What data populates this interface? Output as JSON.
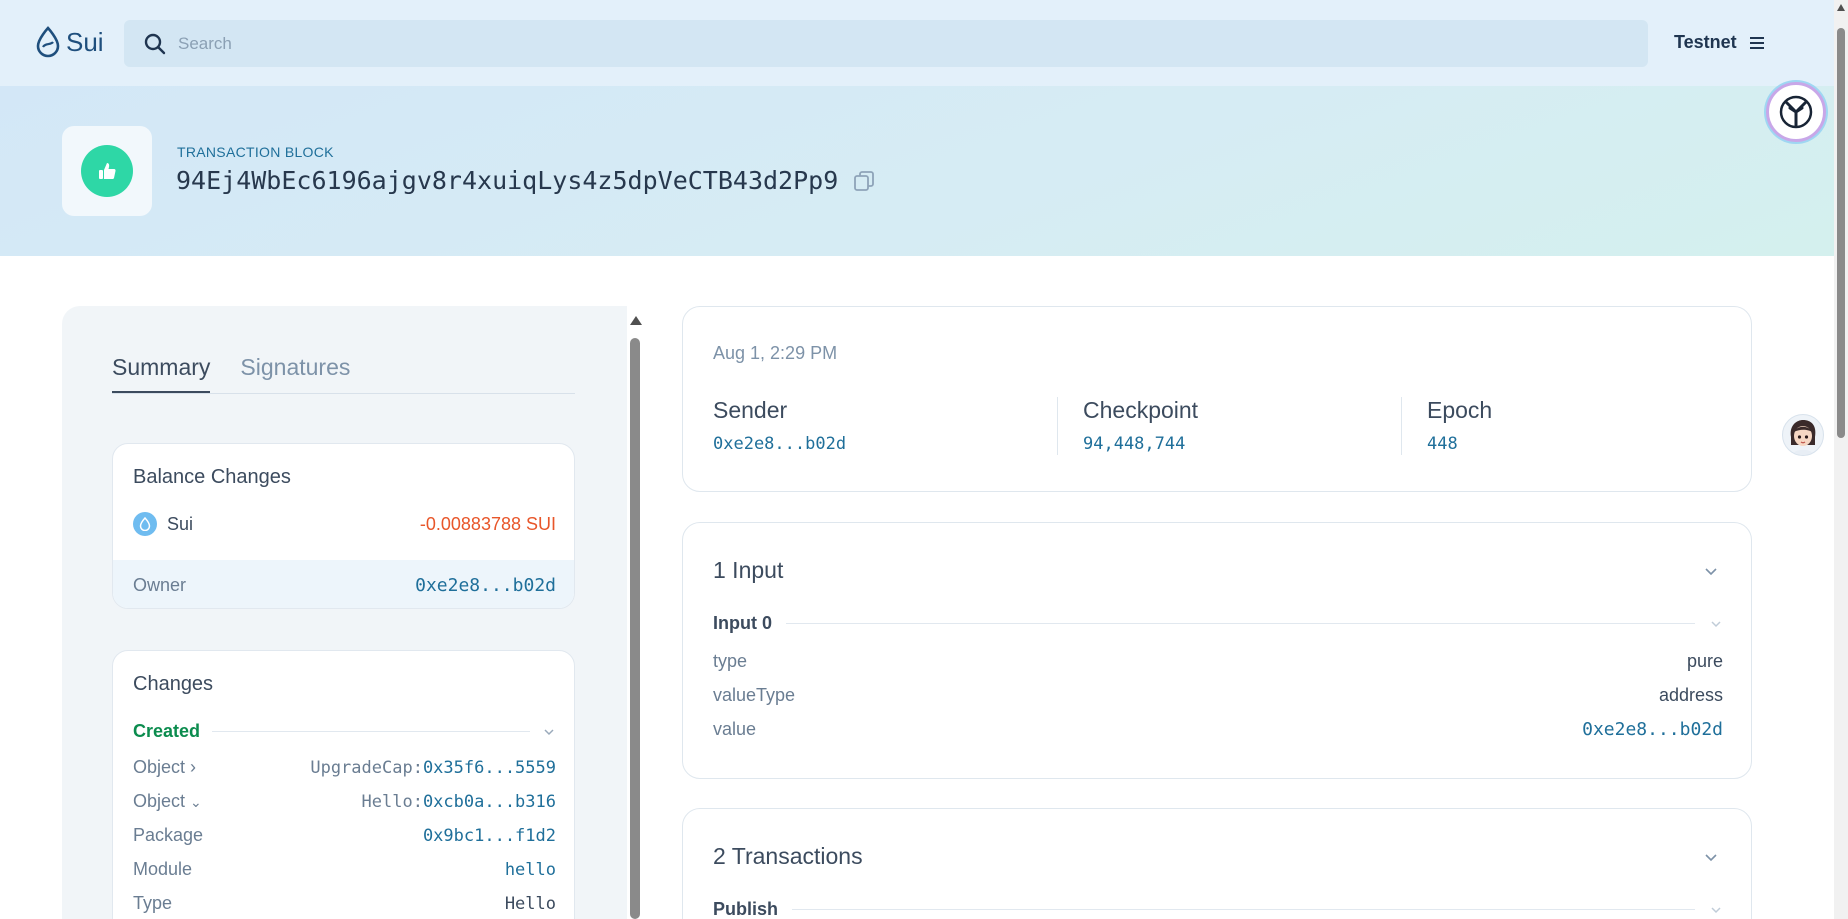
{
  "topbar": {
    "logo_text": "Sui",
    "search_placeholder": "Search",
    "network": "Testnet"
  },
  "header": {
    "label": "TRANSACTION BLOCK",
    "digest": "94Ej4WbEc6196ajgv8r4xuiqLys4z5dpVeCTB43d2Pp9",
    "status_icon": "thumbs-up-icon",
    "status_color": "#2ed7a6"
  },
  "left": {
    "tabs": [
      {
        "label": "Summary",
        "active": true
      },
      {
        "label": "Signatures",
        "active": false
      }
    ],
    "balance_changes": {
      "title": "Balance Changes",
      "coin": "Sui",
      "amount": "-0.00883788 SUI",
      "owner_label": "Owner",
      "owner_value": "0xe2e8...b02d"
    },
    "changes": {
      "title": "Changes",
      "created_label": "Created",
      "rows": [
        {
          "key": "Object",
          "key_icon": "chevron-right-icon",
          "prefix": "UpgradeCap:",
          "value": "0x35f6...5559"
        },
        {
          "key": "Object",
          "key_icon": "chevron-down-icon",
          "prefix": "Hello:",
          "value": "0xcb0a...b316"
        },
        {
          "key": "Package",
          "key_icon": "",
          "prefix": "",
          "value": "0x9bc1...f1d2"
        },
        {
          "key": "Module",
          "key_icon": "",
          "prefix": "",
          "value": "hello"
        },
        {
          "key": "Type",
          "key_icon": "",
          "prefix": "",
          "value": "Hello"
        }
      ]
    }
  },
  "right": {
    "date": "Aug 1, 2:29 PM",
    "sender_label": "Sender",
    "sender_value": "0xe2e8...b02d",
    "checkpoint_label": "Checkpoint",
    "checkpoint_value": "94,448,744",
    "epoch_label": "Epoch",
    "epoch_value": "448",
    "inputs": {
      "title": "1 Input",
      "sub_label": "Input 0",
      "rows": [
        {
          "key": "type",
          "value": "pure"
        },
        {
          "key": "valueType",
          "value": "address"
        },
        {
          "key": "value",
          "value": "0xe2e8...b02d"
        }
      ]
    },
    "transactions": {
      "title": "2 Transactions",
      "sub_label": "Publish"
    }
  },
  "colors": {
    "accent_link": "#1f6f9a",
    "negative": "#e8562a",
    "created": "#0b8c4e"
  }
}
